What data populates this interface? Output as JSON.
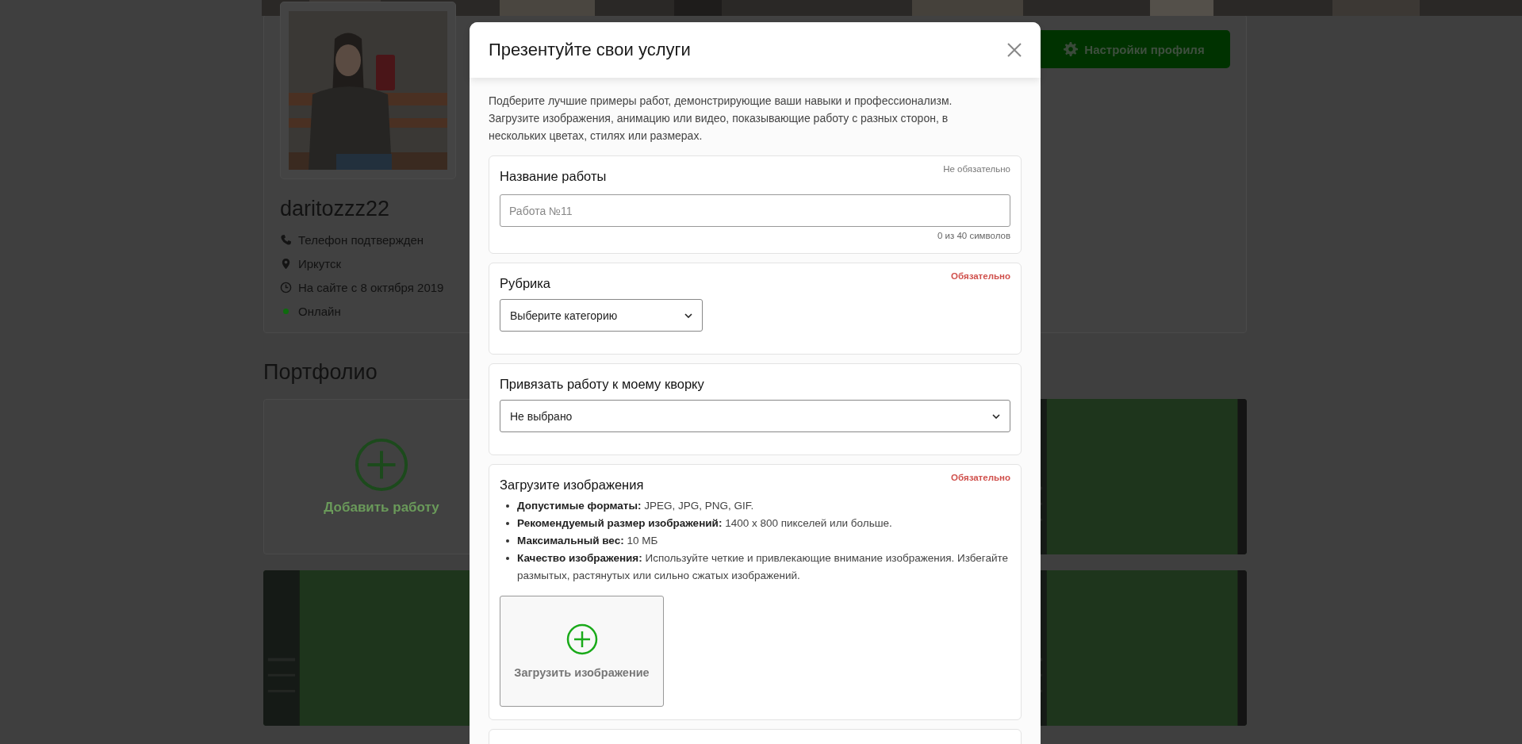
{
  "page": {
    "profile": {
      "username": "daritozzz22",
      "online": true,
      "details": [
        {
          "kind": "phone",
          "text": "Телефон подтвержден"
        },
        {
          "kind": "location",
          "text": "Иркутск"
        },
        {
          "kind": "since",
          "text": "На сайте с 8 октября 2019"
        },
        {
          "kind": "status",
          "text": "Онлайн"
        }
      ],
      "settings_button": "Настройки профиля"
    },
    "portfolio": {
      "title": "Портфолио",
      "add_card": "Добавить работу"
    }
  },
  "modal": {
    "title": "Презентуйте свои услуги",
    "intro": "Подберите лучшие примеры работ, демонстрирующие ваши навыки и профессионализм. Загрузите изображения, анимацию или видео, показывающие работу с разных сторон, в нескольких цветах, стилях или размерах.",
    "sections": [
      {
        "kind": "text_input",
        "title": "Название работы",
        "requirement": "Не обязательно",
        "required": false,
        "placeholder": "Работа №11",
        "counter": "0 из 40 символов"
      },
      {
        "kind": "select",
        "title": "Рубрика",
        "requirement": "Обязательно",
        "required": true,
        "value": "Выберите категорию",
        "wide": false
      },
      {
        "kind": "select",
        "title": "Привязать работу к моему кворку",
        "value": "Не выбрано",
        "wide": true
      },
      {
        "kind": "upload",
        "title": "Загрузите изображения",
        "requirement": "Обязательно",
        "required": true,
        "rules": [
          {
            "label": "Допустимые форматы:",
            "text": "JPEG, JPG, PNG, GIF."
          },
          {
            "label": "Рекомендуемый размер изображений:",
            "text": "1400 x 800 пикселей или больше."
          },
          {
            "label": "Максимальный вес:",
            "text": "10 МБ"
          },
          {
            "label": "Качество изображения:",
            "text": "Используйте четкие и привлекающие внимание изображения. Избегайте размытых, растянутых или сильно сжатых изображений."
          }
        ],
        "upload_label": "Загрузить изображение"
      },
      {
        "kind": "cut_off"
      }
    ]
  }
}
